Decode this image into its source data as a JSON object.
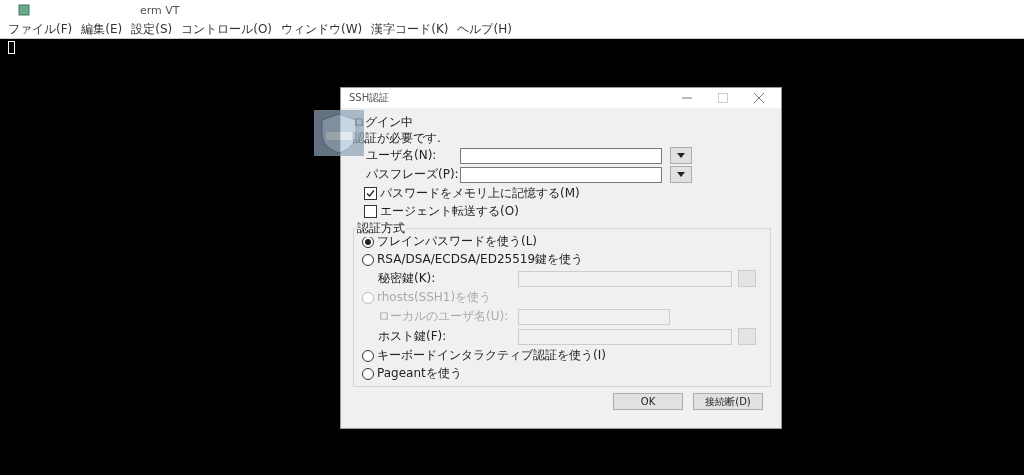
{
  "window": {
    "title": "erm VT"
  },
  "menu": [
    "ファイル(F)",
    "編集(E)",
    "設定(S)",
    "コントロール(O)",
    "ウィンドウ(W)",
    "漢字コード(K)",
    "ヘルプ(H)"
  ],
  "dialog": {
    "title": "SSH認証",
    "messages": [
      "ログイン中",
      "認証が必要です."
    ],
    "fields": [
      {
        "label": "ユーザ名(N):"
      },
      {
        "label": "パスフレーズ(P):"
      }
    ],
    "checkboxes": [
      {
        "label": "パスワードをメモリ上に記憶する(M)",
        "checked": true
      },
      {
        "label": "エージェント転送する(O)",
        "checked": false
      }
    ],
    "auth": {
      "title": "認証方式",
      "items": [
        {
          "kind": "radio",
          "label": "プレインパスワードを使う(L)",
          "selected": true,
          "disabled": false
        },
        {
          "kind": "radio",
          "label": "RSA/DSA/ECDSA/ED25519鍵を使う",
          "selected": false,
          "disabled": false
        },
        {
          "kind": "file",
          "label": "秘密鍵(K):",
          "disabled": false
        },
        {
          "kind": "radio",
          "label": "rhosts(SSH1)を使う",
          "selected": false,
          "disabled": true
        },
        {
          "kind": "text",
          "label": "ローカルのユーザ名(U):",
          "disabled": true
        },
        {
          "kind": "file",
          "label": "ホスト鍵(F):",
          "disabled": false
        },
        {
          "kind": "radio",
          "label": "キーボードインタラクティブ認証を使う(I)",
          "selected": false,
          "disabled": false
        },
        {
          "kind": "radio",
          "label": "Pageantを使う",
          "selected": false,
          "disabled": false
        }
      ]
    },
    "buttons": [
      "OK",
      "接続断(D)"
    ]
  }
}
